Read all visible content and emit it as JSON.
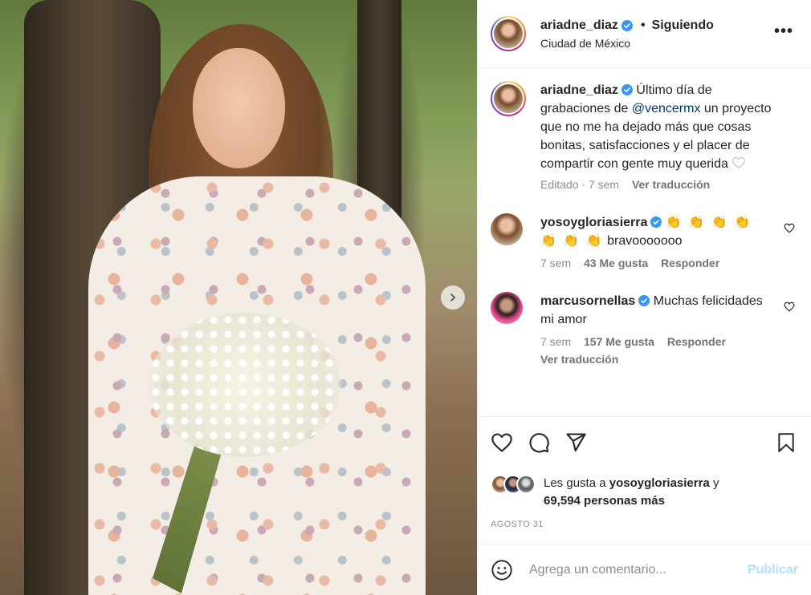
{
  "post": {
    "author": "ariadne_diaz",
    "location": "Ciudad de México",
    "follow_state": "Siguiendo",
    "separator": "•",
    "more_glyph": "•••"
  },
  "caption": {
    "username": "ariadne_diaz",
    "text_before_mention": " Último día de grabaciones de ",
    "mention": "@vencermx",
    "text_after_mention": " un proyecto que no me ha dejado más que cosas bonitas, satisfacciones y el placer de compartir con gente muy querida ",
    "edited_time": "Editado · 7 sem",
    "translate": "Ver traducción"
  },
  "comments": [
    {
      "username": "yosoygloriasierra",
      "claps": "👏 👏 👏 👏 👏 👏 👏",
      "text": " bravooooooo",
      "time": "7 sem",
      "likes": "43 Me gusta",
      "reply": "Responder"
    },
    {
      "username": "marcusornellas",
      "text": " Muchas felicidades mi amor",
      "time": "7 sem",
      "likes": "157 Me gusta",
      "reply": "Responder",
      "translate": "Ver traducción"
    }
  ],
  "likes": {
    "prefix": "Les gusta a ",
    "user": "yosoygloriasierra",
    "conj": " y",
    "count": "69,594 personas más"
  },
  "date": "AGOSTO 31",
  "composer": {
    "placeholder": "Agrega un comentario...",
    "publish": "Publicar"
  },
  "icons": {
    "like": "heart-icon",
    "comment": "comment-icon",
    "share": "share-icon",
    "save": "bookmark-icon",
    "emoji": "emoji-icon",
    "verified": "verified-badge-icon",
    "next": "chevron-right-icon"
  },
  "colors": {
    "verified": "#3897f0",
    "mention": "#00376b",
    "secondary_text": "#8e8e8e",
    "publish_disabled": "#b2dffc"
  }
}
